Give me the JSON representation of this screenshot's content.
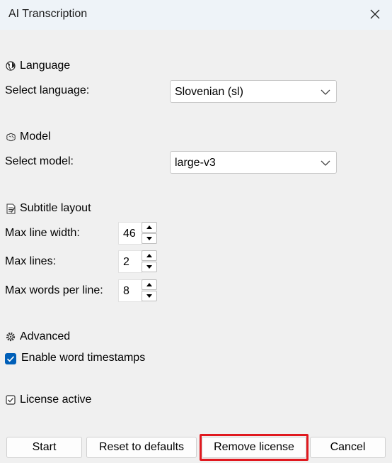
{
  "window": {
    "title": "AI Transcription"
  },
  "language": {
    "heading": "Language",
    "icon": "globe-icon",
    "select_label": "Select language:",
    "selected": "Slovenian (sl)"
  },
  "model": {
    "heading": "Model",
    "icon": "brain-icon",
    "select_label": "Select model:",
    "selected": "large-v3"
  },
  "subtitle_layout": {
    "heading": "Subtitle layout",
    "icon": "memo-icon",
    "max_line_width_label": "Max line width:",
    "max_line_width": "46",
    "max_lines_label": "Max lines:",
    "max_lines": "2",
    "max_words_label": "Max words per line:",
    "max_words": "8"
  },
  "advanced": {
    "heading": "Advanced",
    "icon": "gear-icon",
    "word_timestamps_label": "Enable word timestamps",
    "word_timestamps_checked": true
  },
  "license": {
    "label": "License active",
    "icon": "checkbox-icon"
  },
  "buttons": {
    "start": "Start",
    "reset": "Reset to defaults",
    "remove_license": "Remove license",
    "cancel": "Cancel"
  },
  "colors": {
    "accent": "#005fb8",
    "highlight": "#e0191f"
  }
}
